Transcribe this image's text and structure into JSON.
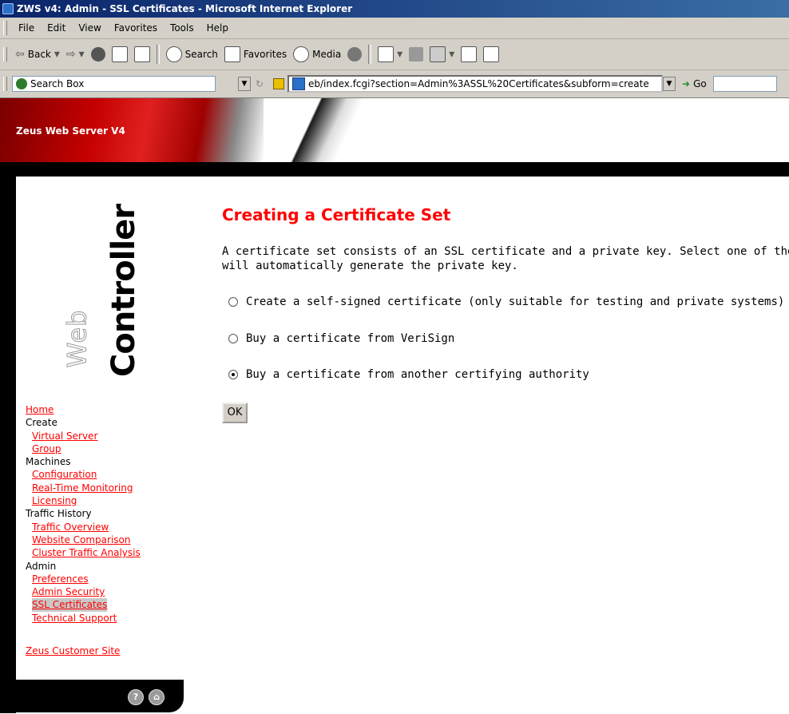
{
  "window": {
    "title": "ZWS v4: Admin - SSL Certificates - Microsoft Internet Explorer"
  },
  "menu": [
    "File",
    "Edit",
    "View",
    "Favorites",
    "Tools",
    "Help"
  ],
  "toolbar": {
    "back": "Back",
    "search": "Search",
    "favorites": "Favorites",
    "media": "Media"
  },
  "address": {
    "search_box": "Search Box",
    "url": "eb/index.fcgi?section=Admin%3ASSL%20Certificates&subform=create",
    "go": "Go"
  },
  "banner": {
    "title": "Zeus Web Server V4"
  },
  "logo": {
    "small": "Web",
    "large": "Controller"
  },
  "nav": {
    "home": "Home",
    "create": "Create",
    "virtual_server": "Virtual Server",
    "group": "Group",
    "machines": "Machines",
    "configuration": "Configuration",
    "real_time_monitoring": "Real-Time Monitoring",
    "licensing": "Licensing",
    "traffic_history": "Traffic History",
    "traffic_overview": "Traffic Overview",
    "website_comparison": "Website Comparison",
    "cluster_traffic_analysis": "Cluster Traffic Analysis",
    "admin": "Admin",
    "preferences": "Preferences",
    "admin_security": "Admin Security",
    "ssl_certificates": "SSL Certificates",
    "technical_support": "Technical Support",
    "customer_site": "Zeus Customer Site"
  },
  "main": {
    "heading": "Creating a Certificate Set",
    "intro_line1": "A certificate set consists of an SSL certificate and a private key. Select one of the f",
    "intro_line2": "will automatically generate the private key.",
    "options": [
      {
        "label": "Create a self-signed certificate (only suitable for testing and private systems)",
        "selected": false
      },
      {
        "label": "Buy a certificate from VeriSign",
        "selected": false
      },
      {
        "label": "Buy a certificate from another certifying authority",
        "selected": true
      }
    ],
    "ok": "OK"
  }
}
